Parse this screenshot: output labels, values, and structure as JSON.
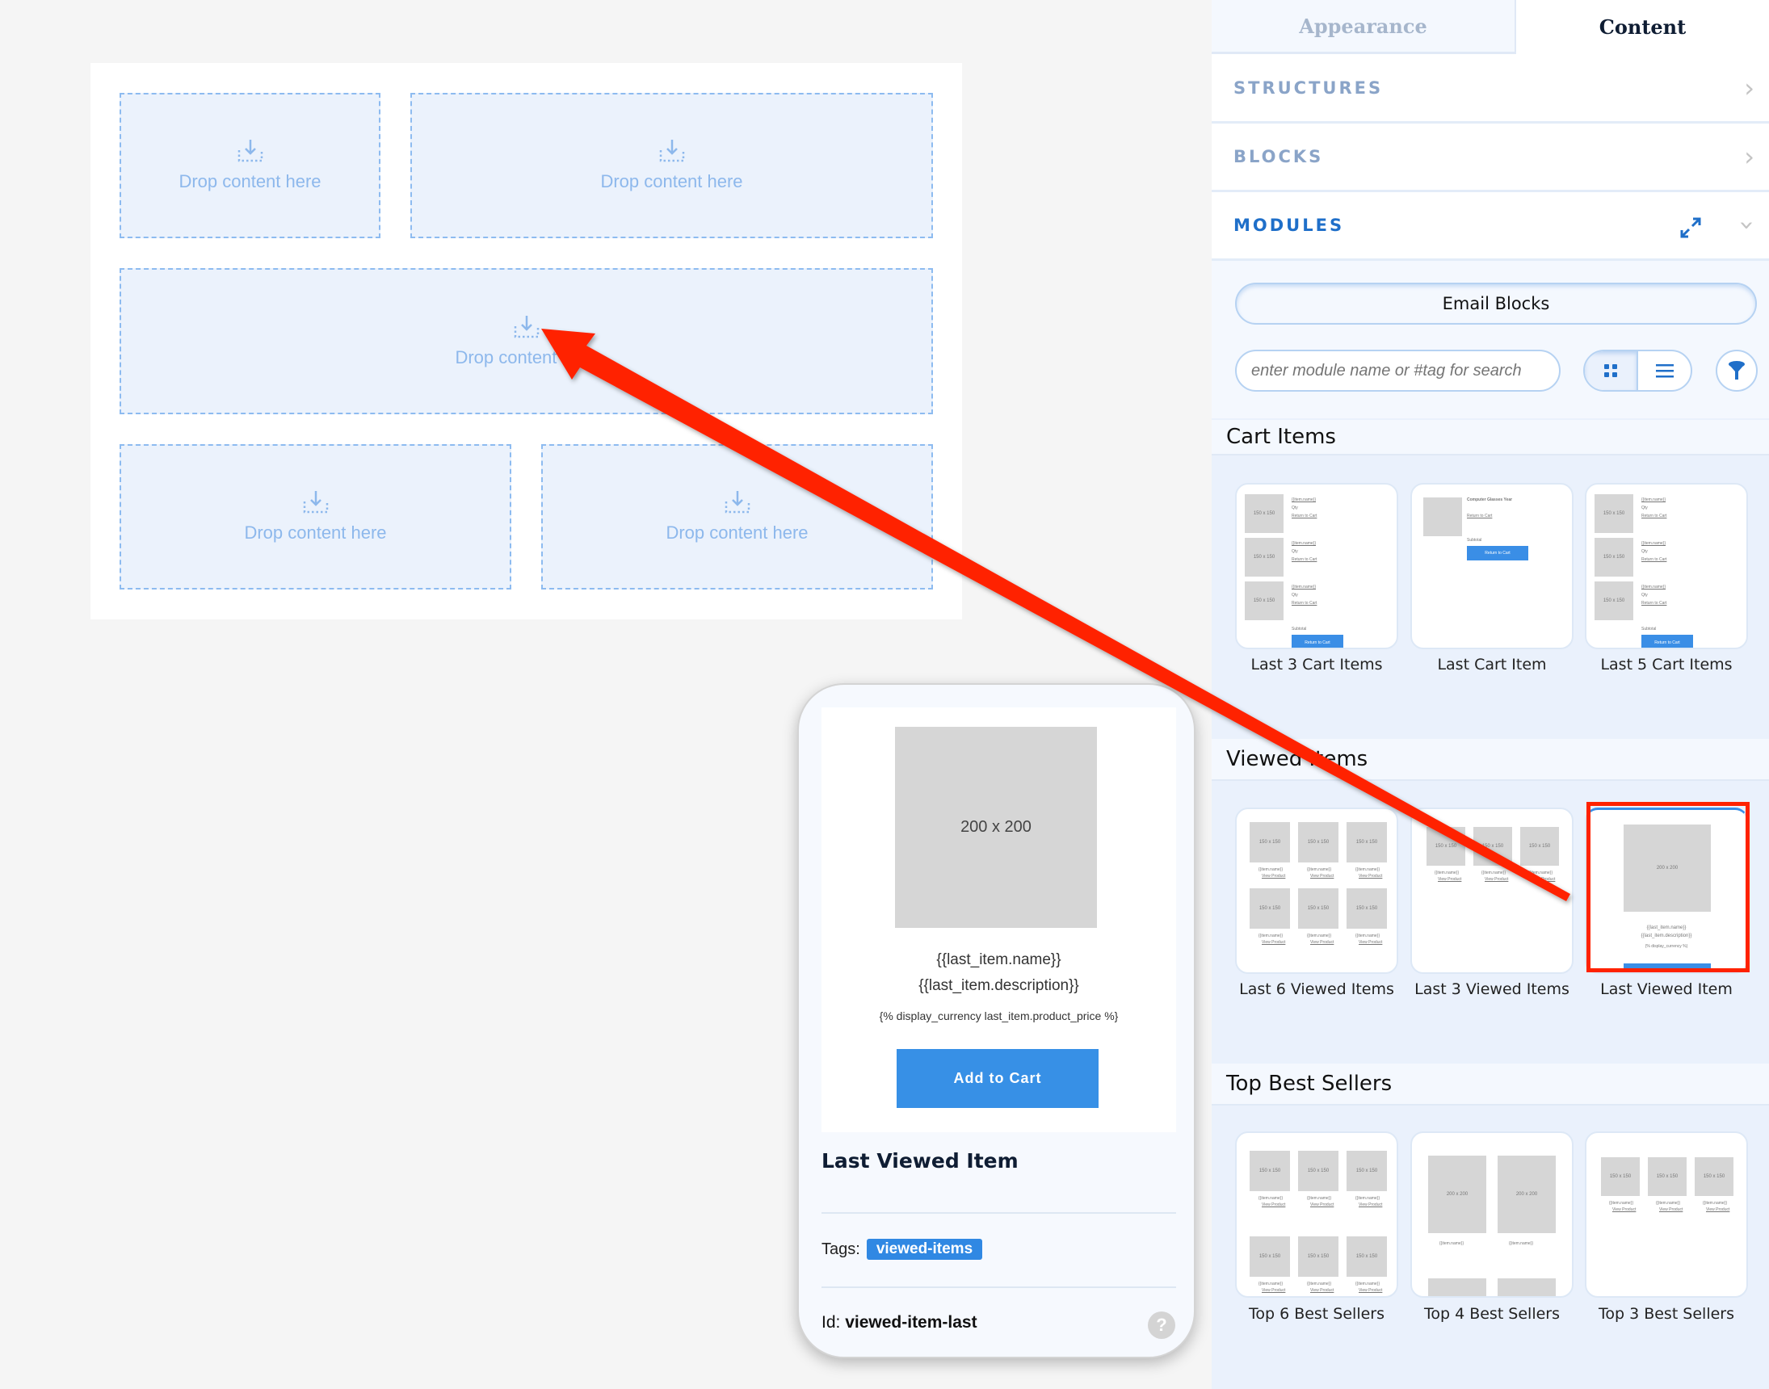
{
  "canvas": {
    "drop_label": "Drop content here"
  },
  "panel": {
    "tabs": [
      {
        "label": "Appearance",
        "active": false
      },
      {
        "label": "Content",
        "active": true
      }
    ],
    "sections": [
      {
        "label": "STRUCTURES"
      },
      {
        "label": "BLOCKS"
      },
      {
        "label": "MODULES",
        "expanded": true
      }
    ],
    "library_select": "Email Blocks",
    "search": {
      "placeholder": "enter module name or #tag for search",
      "value": ""
    },
    "view_mode": "grid",
    "groups": [
      {
        "title": "Cart Items",
        "modules": [
          "Last 3 Cart Items",
          "Last Cart Item",
          "Last 5 Cart Items"
        ]
      },
      {
        "title": "Viewed Items",
        "modules": [
          "Last 6 Viewed Items",
          "Last 3 Viewed Items",
          "Last Viewed Item"
        ]
      },
      {
        "title": "Top Best Sellers",
        "modules": [
          "Top 6 Best Sellers",
          "Top 4 Best Sellers",
          "Top 3 Best Sellers"
        ]
      }
    ],
    "selected_module": "Last Viewed Item",
    "thumb": {
      "p150": "150 x 150",
      "p200": "200 x 200",
      "return": "Return to Cart",
      "item_name": "{{item.name}}",
      "view": "View Product",
      "product": "Computer Glasses Year",
      "add": "Add to Cart"
    }
  },
  "preview": {
    "image_label": "200 x 200",
    "name": "{{last_item.name}}",
    "description": "{{last_item.description}}",
    "price": "{% display_currency last_item.product_price %}",
    "button": "Add to Cart",
    "title": "Last Viewed Item",
    "tags_label": "Tags:",
    "tag": "viewed-items",
    "id_label": "Id:",
    "id_value": "viewed-item-last",
    "help": "?"
  },
  "colors": {
    "accent": "#3a8ee6",
    "annotation": "#ff2200",
    "heading_blue": "#1f6fc9"
  }
}
